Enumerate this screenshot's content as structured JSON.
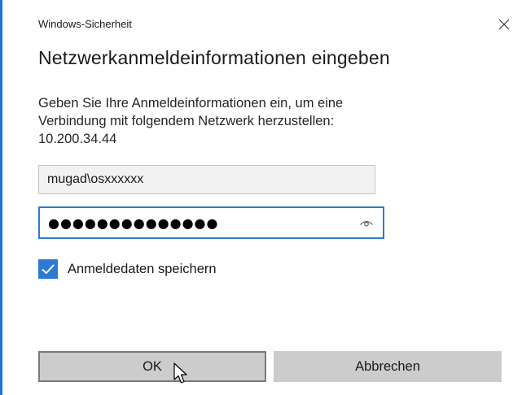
{
  "window": {
    "title": "Windows-Sicherheit",
    "close_icon": "close-icon",
    "accent_color": "#1a76d2"
  },
  "dialog": {
    "heading": "Netzwerkanmeldeinformationen eingeben",
    "message_lines": [
      "Geben Sie Ihre Anmeldeinformationen ein, um eine",
      "Verbindung mit folgendem Netzwerk herzustellen:",
      "10.200.34.44"
    ]
  },
  "credentials": {
    "username_value": "mugad\\osxxxxxx",
    "password_value": "●●●●●●●●●●●●●●",
    "reveal_icon": "eye-icon"
  },
  "remember": {
    "checked": true,
    "label": "Anmeldedaten speichern",
    "check_color": "#2e7ad1"
  },
  "buttons": {
    "ok_label": "OK",
    "cancel_label": "Abbrechen"
  }
}
